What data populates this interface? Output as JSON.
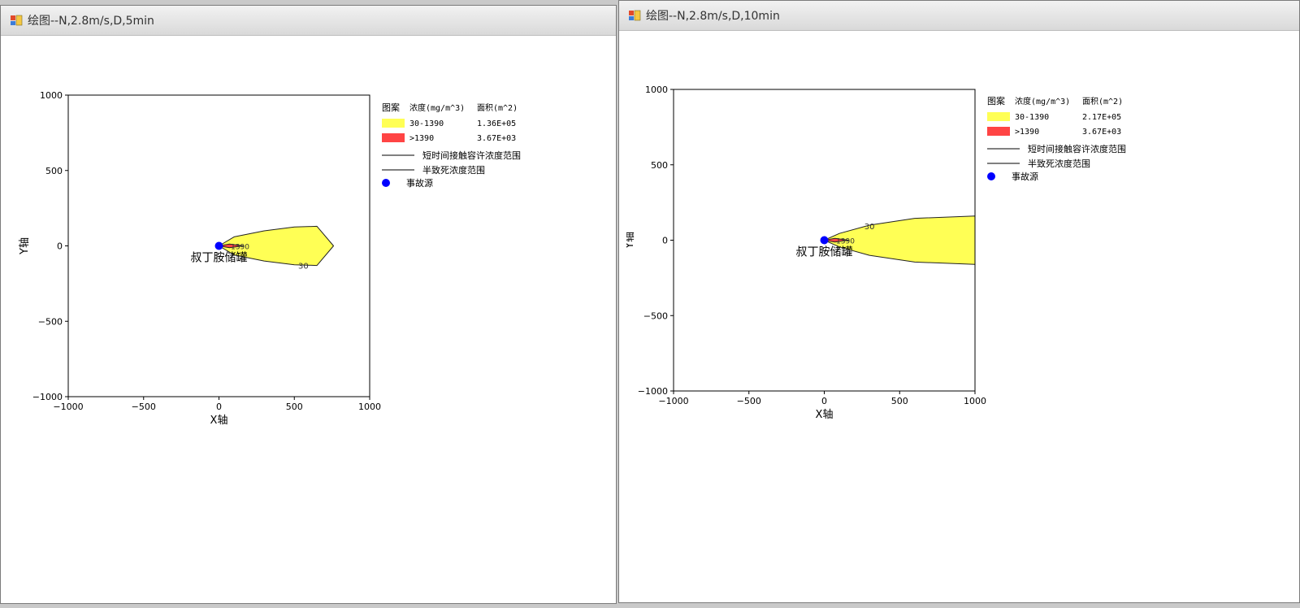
{
  "windows": [
    {
      "title": "绘图--N,2.8m/s,D,5min",
      "xlabel": "X轴",
      "ylabel": "Y轴",
      "xticks": [
        "-1000",
        "-500",
        "0",
        "500",
        "1000"
      ],
      "yticks": [
        "1000",
        "500",
        "0",
        "-500",
        "-1000"
      ],
      "source_label": "叔丁胺储罐",
      "contour_labels": [
        "30",
        "1390"
      ],
      "legend": {
        "header_pattern": "图案",
        "header_conc": "浓度(mg/m^3)",
        "header_area": "面积(m^2)",
        "rows": [
          {
            "range": "30-1390",
            "area": "1.36E+05",
            "color": "#ffff55"
          },
          {
            "range": ">1390",
            "area": "3.67E+03",
            "color": "#ff4444"
          }
        ],
        "line_items": [
          "短时间接触容许浓度范围",
          "半致死浓度范围"
        ],
        "source_item": "事故源",
        "source_color": "#0000ff"
      }
    },
    {
      "title": "绘图--N,2.8m/s,D,10min",
      "xlabel": "X轴",
      "ylabel": "Y轴",
      "xticks": [
        "-1000",
        "-500",
        "0",
        "500",
        "1000"
      ],
      "yticks": [
        "1000",
        "500",
        "0",
        "-500",
        "-1000"
      ],
      "source_label": "叔丁胺储罐",
      "contour_labels": [
        "30",
        "1390"
      ],
      "legend": {
        "header_pattern": "图案",
        "header_conc": "浓度(mg/m^3)",
        "header_area": "面积(m^2)",
        "rows": [
          {
            "range": "30-1390",
            "area": "2.17E+05",
            "color": "#ffff55"
          },
          {
            "range": ">1390",
            "area": "3.67E+03",
            "color": "#ff4444"
          }
        ],
        "line_items": [
          "短时间接触容许浓度范围",
          "半致死浓度范围"
        ],
        "source_item": "事故源",
        "source_color": "#0000ff"
      }
    }
  ],
  "chart_data": [
    {
      "type": "area",
      "xlabel": "X轴",
      "ylabel": "Y轴",
      "xlim": [
        -1000,
        1000
      ],
      "ylim": [
        -1000,
        1000
      ],
      "series": [
        {
          "name": "30-1390",
          "x": [
            0,
            100,
            300,
            500,
            650,
            760,
            650,
            500,
            300,
            100,
            0
          ],
          "y": [
            0,
            60,
            100,
            125,
            130,
            0,
            -130,
            -125,
            -100,
            -60,
            0
          ]
        },
        {
          "name": ">1390",
          "x": [
            0,
            70,
            160,
            70,
            0
          ],
          "y": [
            0,
            12,
            0,
            -12,
            0
          ]
        }
      ],
      "source_point": {
        "x": 0,
        "y": 0
      }
    },
    {
      "type": "area",
      "xlabel": "X轴",
      "ylabel": "Y轴",
      "xlim": [
        -1000,
        1000
      ],
      "ylim": [
        -1000,
        1000
      ],
      "series": [
        {
          "name": "30-1390",
          "x": [
            0,
            100,
            300,
            600,
            1000,
            1000,
            600,
            300,
            100,
            0
          ],
          "y": [
            0,
            45,
            100,
            145,
            160,
            -160,
            -145,
            -100,
            -45,
            0
          ]
        },
        {
          "name": ">1390",
          "x": [
            0,
            70,
            160,
            70,
            0
          ],
          "y": [
            0,
            12,
            0,
            -12,
            0
          ]
        }
      ],
      "source_point": {
        "x": 0,
        "y": 0
      }
    }
  ]
}
